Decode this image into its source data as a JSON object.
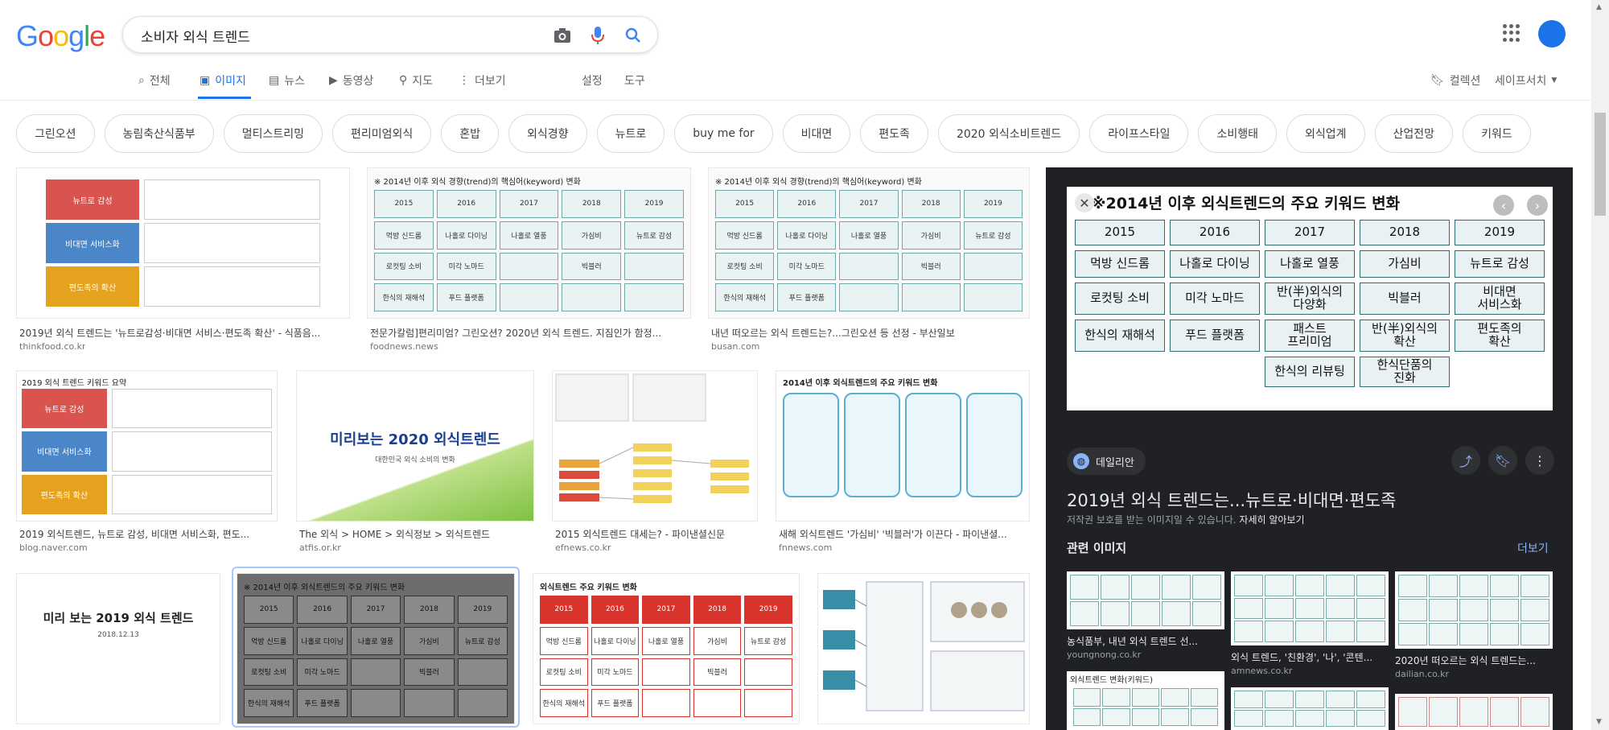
{
  "search": {
    "query": "소비자 외식 트렌드"
  },
  "logo": {
    "letters": [
      "G",
      "o",
      "o",
      "g",
      "l",
      "e"
    ],
    "colors": [
      "#4285f4",
      "#ea4335",
      "#fbbc05",
      "#4285f4",
      "#34a853",
      "#ea4335"
    ]
  },
  "tabs": [
    {
      "label": "전체",
      "icon": "search-icon"
    },
    {
      "label": "이미지",
      "icon": "image-icon",
      "active": true
    },
    {
      "label": "뉴스",
      "icon": "news-icon"
    },
    {
      "label": "동영상",
      "icon": "video-icon"
    },
    {
      "label": "지도",
      "icon": "map-pin-icon"
    },
    {
      "label": "더보기",
      "icon": "more-icon"
    }
  ],
  "tools": {
    "settings": "설정",
    "tools": "도구"
  },
  "right_header": {
    "collections": "컬렉션",
    "safesearch": "세이프서치"
  },
  "chips": [
    "그린오션",
    "농림축산식품부",
    "멀티스트리밍",
    "편리미엄외식",
    "혼밥",
    "외식경향",
    "뉴트로",
    "buy me for",
    "비대면",
    "편도족",
    "2020 외식소비트렌드",
    "라이프스타일",
    "소비행태",
    "외식업계",
    "산업전망",
    "키워드"
  ],
  "results": [
    {
      "caption": "2019년 외식 트렌드는 '뉴트로감성·비대면 서비스·편도족 확산' - 식품음...",
      "source": "thinkfood.co.kr"
    },
    {
      "caption": "전문가칼럼]편리미엄? 그린오션? 2020년 외식 트렌드. 지짐인가 함정...",
      "source": "foodnews.news"
    },
    {
      "caption": "내년 떠오르는 외식 트렌드는?...그린오션 등 선정 - 부산일보",
      "source": "busan.com"
    },
    {
      "caption": "2019 외식트렌드, 뉴트로 감성, 비대면 서비스화, 편도...",
      "source": "blog.naver.com"
    },
    {
      "caption": "The 외식 > HOME > 외식정보 > 외식트렌드",
      "source": "atfis.or.kr"
    },
    {
      "caption": "2015 외식트렌드 대세는? - 파이낸셜신문",
      "source": "efnews.co.kr"
    },
    {
      "caption": "새해 외식트렌드 '가심비' '빅블러'가 이끈다 - 파이낸셜...",
      "source": "fnnews.com"
    }
  ],
  "thumb_text": {
    "kw_labels": [
      "뉴트로 감성",
      "비대면 서비스화",
      "편도족의 확산"
    ],
    "kw_title": "2019 외식 트렌드 키워드 요약",
    "table_title": "※ 2014년 이후 외식 경향(trend)의 핵심어(keyword) 변화",
    "table_title_short": "※ 2014년 이후 외식트렌드의 주요 키워드 변화",
    "banner1_big": "미리보는 2020 외식트렌드",
    "banner1_small": "대한민국 외식 소비의 변화",
    "banner2_big": "미리 보는 2019 외식 트렌드",
    "banner2_small": "2018.12.13",
    "red_title": "외식트렌드 주요 키워드 변화",
    "fn_title": "2014년 이후 외식트렌드의 주요 키워드 변화"
  },
  "panel": {
    "image_title": "※2014년 이후 외식트렌드의 주요 키워드 변화",
    "years": [
      "2015",
      "2016",
      "2017",
      "2018",
      "2019"
    ],
    "rows": [
      [
        "먹방 신드롬",
        "나홀로 다이닝",
        "나홀로 열풍",
        "가심비",
        "뉴트로 감성"
      ],
      [
        "로컷팅 소비",
        "미각 노마드",
        "반(半)외식의\n다양화",
        "빅블러",
        "비대면\n서비스화"
      ],
      [
        "한식의 재해석",
        "푸드 플랫폼",
        "패스트\n프리미엄",
        "반(半)외식의\n확산",
        "편도족의\n확산"
      ],
      [
        "",
        "",
        "한식의 리뷰팅",
        "한식단품의\n진화",
        ""
      ]
    ],
    "site": "데일리안",
    "title": "2019년 외식 트렌드는...뉴트로·비대면·편도족",
    "copyright": "저작권 보호를 받는 이미지일 수 있습니다.",
    "learn_more": "자세히 알아보기",
    "related_heading": "관련 이미지",
    "related_more": "더보기",
    "related": [
      {
        "caption": "농식품부, 내년 외식 트렌드 선...",
        "source": "youngnong.co.kr"
      },
      {
        "caption": "외식 트렌드, '친환경', '나', '콘텐...",
        "source": "amnews.co.kr"
      },
      {
        "caption": "2020년 떠오르는 외식 트렌드는...",
        "source": "dailian.co.kr"
      },
      {
        "caption": "외식트렌드 변화(키워드)",
        "source": ""
      }
    ]
  },
  "colors": {
    "accent": "#1a73e8",
    "panel_bg": "#202124"
  }
}
